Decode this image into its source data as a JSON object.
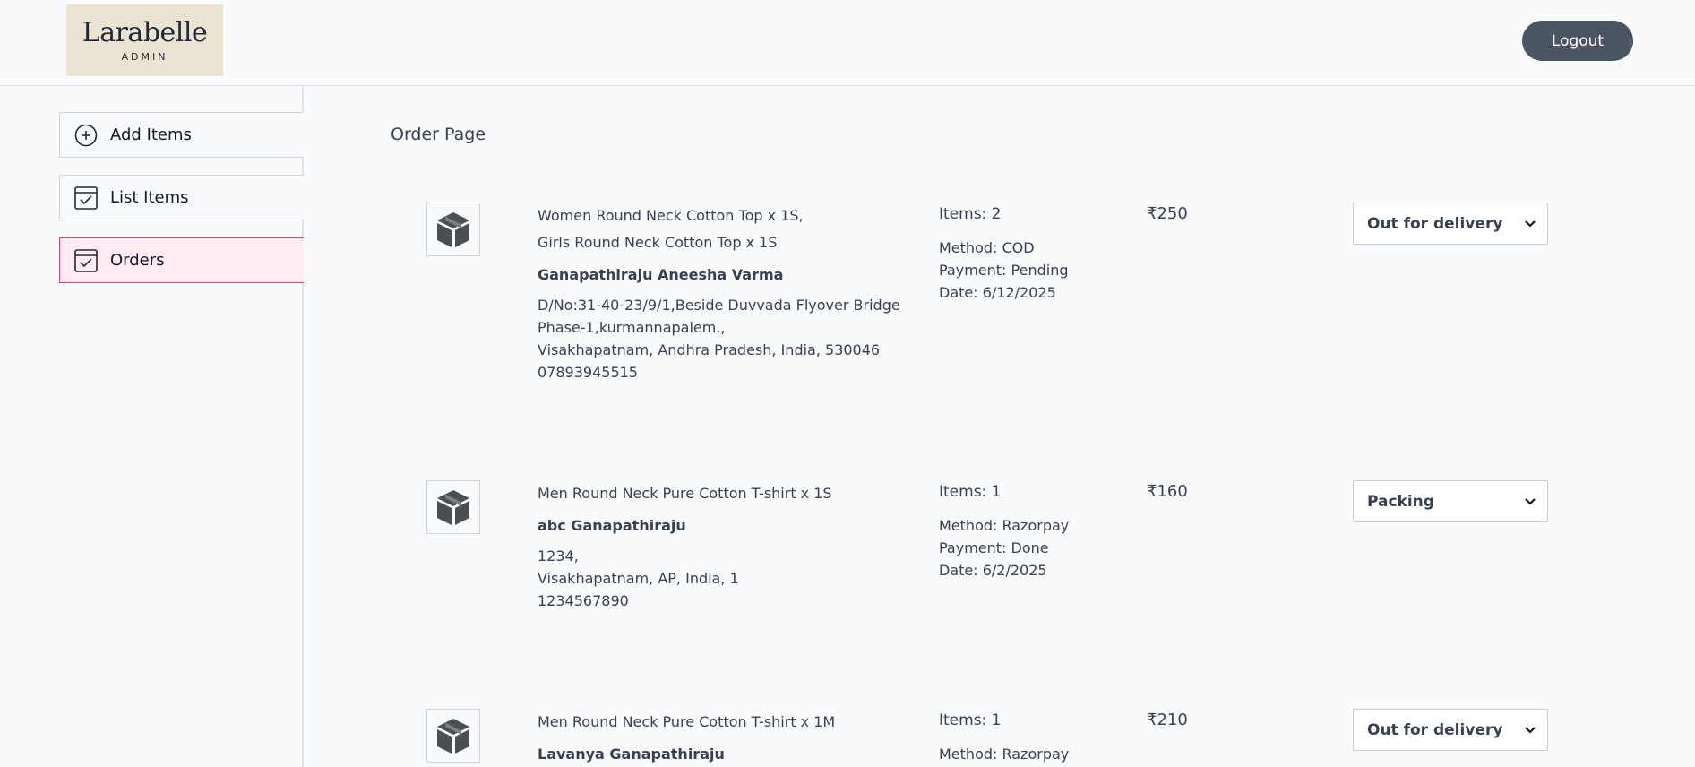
{
  "header": {
    "logo_name": "Larabelle",
    "logo_sub": "ADMIN",
    "logout_label": "Logout"
  },
  "sidebar": {
    "items": [
      {
        "label": "Add Items",
        "icon": "plus-circle-icon"
      },
      {
        "label": "List Items",
        "icon": "checklist-icon"
      },
      {
        "label": "Orders",
        "icon": "checklist-icon",
        "active": true
      }
    ]
  },
  "main": {
    "title": "Order Page",
    "orders": [
      {
        "products": [
          "Women Round Neck Cotton Top x 1S,",
          "Girls Round Neck Cotton Top x 1S"
        ],
        "customer": "Ganapathiraju Aneesha Varma",
        "address_lines": [
          "D/No:31-40-23/9/1,Beside Duvvada Flyover Bridge",
          "Phase-1,kurmannapalem.,",
          "Visakhapatnam, Andhra Pradesh, India, 530046",
          "07893945515"
        ],
        "items_count": "Items: 2",
        "method": "Method: COD",
        "payment": "Payment: Pending",
        "date": "Date: 6/12/2025",
        "amount": "₹250",
        "status": "Out for delivery"
      },
      {
        "products": [
          "Men Round Neck Pure Cotton T-shirt x 1S"
        ],
        "customer": "abc Ganapathiraju",
        "address_lines": [
          "1234,",
          "Visakhapatnam, AP, India, 1",
          "1234567890"
        ],
        "items_count": "Items: 1",
        "method": "Method: Razorpay",
        "payment": "Payment: Done",
        "date": "Date: 6/2/2025",
        "amount": "₹160",
        "status": "Packing"
      },
      {
        "products": [
          "Men Round Neck Pure Cotton T-shirt x 1M"
        ],
        "customer": "Lavanya Ganapathiraju",
        "address_lines": [],
        "items_count": "Items: 1",
        "method": "Method: Razorpay",
        "payment": "",
        "date": "",
        "amount": "₹210",
        "status": "Out for delivery"
      }
    ]
  },
  "colors": {
    "logo_bg": "#ece4d3",
    "logout_bg": "#4b5563",
    "active_bg": "#ffebf1",
    "active_border": "#c4476f"
  }
}
